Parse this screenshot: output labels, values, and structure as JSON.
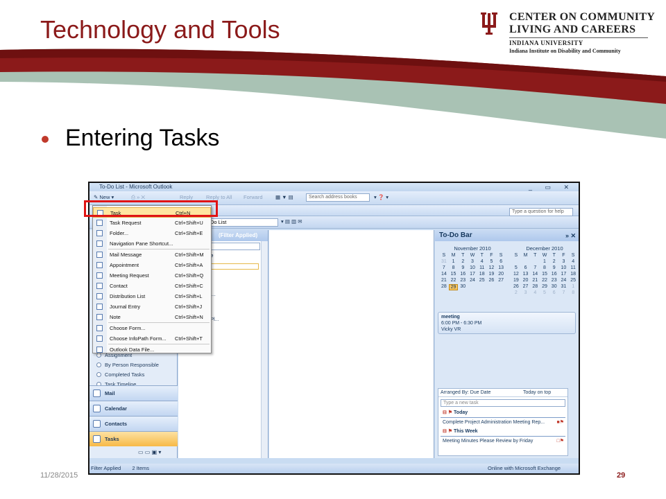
{
  "slide": {
    "title": "Technology and Tools",
    "bullet": "Entering Tasks",
    "footer_date": "11/28/2015",
    "page_number": "29",
    "colors": {
      "title": "#8b1a1a",
      "swoosh_red": "#8b1a1a",
      "swoosh_green": "#a9c2b4"
    }
  },
  "org": {
    "line1": "CENTER ON COMMUNITY",
    "line2": "LIVING AND CAREERS",
    "line3": "INDIANA UNIVERSITY",
    "line4": "Indiana Institute on Disability and Community"
  },
  "window": {
    "title": "To-Do List - Microsoft Outlook",
    "toolbar": {
      "new": "New",
      "reply": "Reply",
      "reply_all": "Reply to All",
      "forward": "Forward",
      "search_address_books": "Search address books",
      "help_placeholder": "Type a question for help",
      "view_selector": "Do List"
    },
    "new_menu": [
      {
        "label": "Task",
        "shortcut": "Ctrl+N",
        "highlighted": true
      },
      {
        "label": "Task Request",
        "shortcut": "Ctrl+Shift+U"
      },
      {
        "label": "Folder...",
        "shortcut": "Ctrl+Shift+E"
      },
      {
        "label": "Navigation Pane Shortcut...",
        "shortcut": ""
      },
      {
        "label": "Mail Message",
        "shortcut": "Ctrl+Shift+M"
      },
      {
        "label": "Appointment",
        "shortcut": "Ctrl+Shift+A"
      },
      {
        "label": "Meeting Request",
        "shortcut": "Ctrl+Shift+Q"
      },
      {
        "label": "Contact",
        "shortcut": "Ctrl+Shift+C"
      },
      {
        "label": "Distribution List",
        "shortcut": "Ctrl+Shift+L"
      },
      {
        "label": "Journal Entry",
        "shortcut": "Ctrl+Shift+J"
      },
      {
        "label": "Note",
        "shortcut": "Ctrl+Shift+N"
      },
      {
        "label": "Choose Form...",
        "shortcut": ""
      },
      {
        "label": "Choose InfoPath Form...",
        "shortcut": "Ctrl+Shift+T"
      },
      {
        "label": "Outlook Data File...",
        "shortcut": ""
      }
    ],
    "nav": {
      "radios": [
        "Assignment",
        "By Person Responsible",
        "Completed Tasks",
        "Task Timeline"
      ],
      "buttons": [
        "Mail",
        "Calendar",
        "Contacts",
        "Tasks"
      ]
    },
    "task_list": {
      "header": "(Filter Applied)",
      "search_placeholder": "List",
      "column": "Due Date",
      "new_task": "ask",
      "group1": "y",
      "item1": "Project A...",
      "group2": "Week",
      "item2": "Minutes Pl..."
    },
    "todo_bar": {
      "title": "To-Do Bar",
      "cal1": {
        "month": "November 2010",
        "days": [
          "S",
          "M",
          "T",
          "W",
          "T",
          "F",
          "S"
        ],
        "dates": [
          "31",
          "1",
          "2",
          "3",
          "4",
          "5",
          "6",
          "7",
          "8",
          "9",
          "10",
          "11",
          "12",
          "13",
          "14",
          "15",
          "16",
          "17",
          "18",
          "19",
          "20",
          "21",
          "22",
          "23",
          "24",
          "25",
          "26",
          "27",
          "28",
          "29",
          "30",
          "",
          "",
          "",
          ""
        ]
      },
      "cal2": {
        "month": "December 2010",
        "days": [
          "S",
          "M",
          "T",
          "W",
          "T",
          "F",
          "S"
        ],
        "dates": [
          "",
          "",
          "",
          "1",
          "2",
          "3",
          "4",
          "5",
          "6",
          "7",
          "8",
          "9",
          "10",
          "11",
          "12",
          "13",
          "14",
          "15",
          "16",
          "17",
          "18",
          "19",
          "20",
          "21",
          "22",
          "23",
          "24",
          "25",
          "26",
          "27",
          "28",
          "29",
          "30",
          "31",
          "1",
          "2",
          "3",
          "4",
          "5",
          "6",
          "7",
          "8"
        ]
      },
      "appointment": {
        "title": "meeting",
        "time": "6:00 PM - 6:30 PM",
        "location": "Vicky VR"
      },
      "tasks": {
        "arranged_by": "Arranged By: Due Date",
        "sort": "Today on top",
        "new_placeholder": "Type a new task",
        "group_today": "Today",
        "task_today": "Complete Project Administration Meeting Rep...",
        "group_week": "This Week",
        "task_week": "Meeting Minutes Please Review by Friday"
      }
    },
    "status": {
      "filter": "Filter Applied",
      "items": "2 Items",
      "connection": "Online with Microsoft Exchange"
    }
  }
}
